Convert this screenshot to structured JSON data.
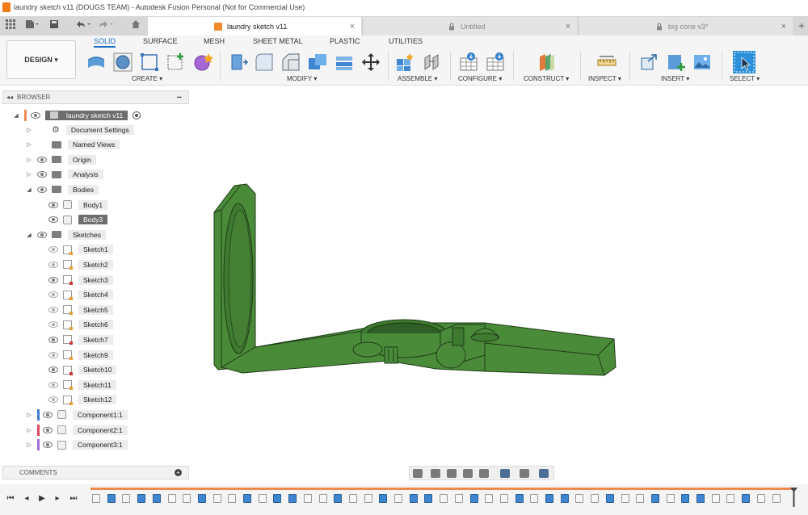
{
  "window": {
    "title": "laundry sketch v11 (DOUGS TEAM) - Autodesk Fusion Personal (Not for Commercial Use)"
  },
  "tabs": [
    {
      "label": "laundry sketch v11",
      "active": true,
      "close": "×"
    },
    {
      "label": "Untitled",
      "active": false,
      "close": "×"
    },
    {
      "label": "big cone v3*",
      "active": false,
      "close": "×"
    }
  ],
  "tab_add": "+",
  "design_button": "DESIGN ▾",
  "workspace_tabs": [
    "SOLID",
    "SURFACE",
    "MESH",
    "SHEET METAL",
    "PLASTIC",
    "UTILITIES"
  ],
  "tool_groups": [
    "CREATE ▾",
    "MODIFY ▾",
    "ASSEMBLE ▾",
    "CONFIGURE ▾",
    "CONSTRUCT ▾",
    "INSPECT ▾",
    "INSERT ▾",
    "SELECT ▾"
  ],
  "browser": {
    "title": "BROWSER",
    "collapse": "−",
    "root": "laundry sketch v11",
    "items": [
      {
        "label": "Document Settings",
        "icon": "gear-icon"
      },
      {
        "label": "Named Views",
        "icon": "folder-icon"
      },
      {
        "label": "Origin",
        "icon": "folder-icon"
      },
      {
        "label": "Analysis",
        "icon": "folder-icon"
      },
      {
        "label": "Bodies",
        "icon": "folder-icon",
        "expanded": true
      },
      {
        "label": "Body1",
        "icon": "body-icon"
      },
      {
        "label": "Body3",
        "icon": "body-icon",
        "selected": true
      },
      {
        "label": "Sketches",
        "icon": "folder-icon",
        "expanded": true
      },
      {
        "label": "Sketch1",
        "icon": "sketch-icon"
      },
      {
        "label": "Sketch2",
        "icon": "sketch-icon"
      },
      {
        "label": "Sketch3",
        "icon": "sketch-icon",
        "warning": true
      },
      {
        "label": "Sketch4",
        "icon": "sketch-icon"
      },
      {
        "label": "Sketch5",
        "icon": "sketch-icon"
      },
      {
        "label": "Sketch6",
        "icon": "sketch-icon"
      },
      {
        "label": "Sketch7",
        "icon": "sketch-icon",
        "warning": true
      },
      {
        "label": "Sketch9",
        "icon": "sketch-icon"
      },
      {
        "label": "Sketch10",
        "icon": "sketch-icon",
        "warning": true
      },
      {
        "label": "Sketch11",
        "icon": "sketch-icon"
      },
      {
        "label": "Sketch12",
        "icon": "sketch-icon"
      },
      {
        "label": "Component1:1",
        "icon": "component-icon",
        "color": "#3f7fd1"
      },
      {
        "label": "Component2:1",
        "icon": "component-icon",
        "color": "#e0475b"
      },
      {
        "label": "Component3:1",
        "icon": "component-icon",
        "color": "#a66ed8"
      }
    ]
  },
  "comments": {
    "label": "COMMENTS",
    "add": "+"
  },
  "colors": {
    "accent": "#1b6fc2",
    "model_green": "#3e7a30",
    "timeline_track": "#ef8a4e"
  }
}
